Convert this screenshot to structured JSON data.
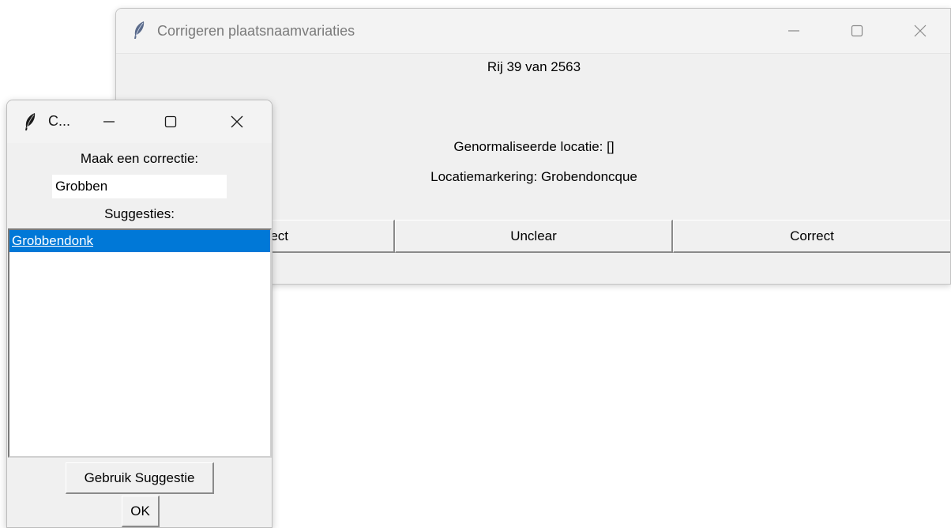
{
  "main_window": {
    "title": "Corrigeren plaatsnaamvariaties",
    "row_counter": "Rij 39 van 2563",
    "normalized_location": "Genormaliseerde locatie: []",
    "location_marker": "Locatiemarkering: Grobendoncque",
    "buttons": {
      "incorrect_partial": "ect",
      "unclear": "Unclear",
      "correct": "Correct"
    }
  },
  "dialog": {
    "title": "C...",
    "correction_label": "Maak een correctie:",
    "correction_value": "Grobben",
    "suggestions_label": "Suggesties:",
    "suggestions": [
      "Grobbendonk"
    ],
    "selected_suggestion_index": 0,
    "use_suggestion_button": "Gebruik Suggestie",
    "ok_button": "OK"
  },
  "icons": {
    "app_icon": "feather-icon",
    "minimize": "minimize-icon",
    "maximize": "maximize-icon",
    "close": "close-icon"
  },
  "colors": {
    "selection": "#0078d7",
    "window_bg": "#f0f0f0"
  }
}
